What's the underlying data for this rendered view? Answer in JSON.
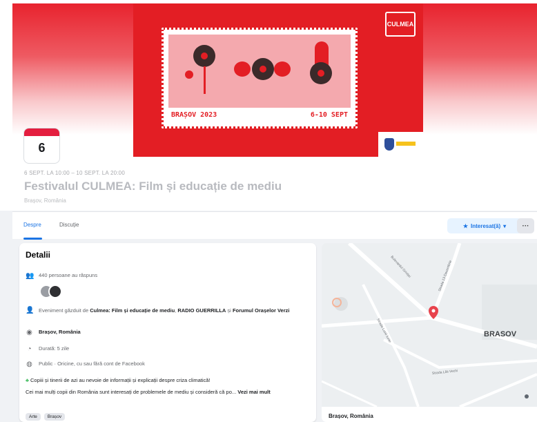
{
  "cover": {
    "poster_city_year": "BRAȘOV 2023",
    "poster_dates": "6-10 SEPT",
    "poster_logo": "CULMEA"
  },
  "calendar": {
    "day": "6"
  },
  "event": {
    "date_range": "6 SEPT. LA 10:00 – 10 SEPT. LA 20:00",
    "title": "Festivalul CULMEA: Film și educație de mediu",
    "location": "Brașov, România"
  },
  "tabs": [
    {
      "label": "Despre"
    },
    {
      "label": "Discuție"
    }
  ],
  "actions": {
    "interest_label": "Interesat(ă)",
    "more_label": "···"
  },
  "details": {
    "heading": "Detalii",
    "responses": "440 persoane au răspuns",
    "hosted_prefix": "Eveniment găzduit de ",
    "host1": "Culmea: Film și educație de mediu",
    "host_sep": ", ",
    "host2": "RADIO GUERRILLA",
    "host_and": " și ",
    "host3": "Forumul Orașelor Verzi",
    "location": "Brașov, România",
    "duration": "Durată: 5 zile",
    "privacy": "Public · Oricine, cu sau fără cont de Facebook",
    "desc1": "Copiii și tinerii de azi au nevoie de informații și explicații despre criza climatică!",
    "desc2": "Cei mai mulți copii din România sunt interesați de problemele de mediu și consideră că po...",
    "see_more": "Vezi mai mult",
    "tags": [
      "Arte",
      "Brașov"
    ]
  },
  "map": {
    "city_label": "BRASOV",
    "street1": "Bulevardul Griviței",
    "street2": "Strada 13 Decembrie",
    "street3": "Strada Lunii Iunie",
    "street4": "Strada Lăii Vechi",
    "caption": "Brașov, România"
  },
  "colors": {
    "brand_red": "#e31e24",
    "facebook_blue": "#1b74e4",
    "calendar_red": "#e41e3f",
    "map_pin": "#e8434d"
  },
  "icons": [
    "people-icon",
    "host-icon",
    "location-pin-icon",
    "clock-icon",
    "globe-icon",
    "leaf-icon",
    "star-icon",
    "chevron-down-icon"
  ]
}
